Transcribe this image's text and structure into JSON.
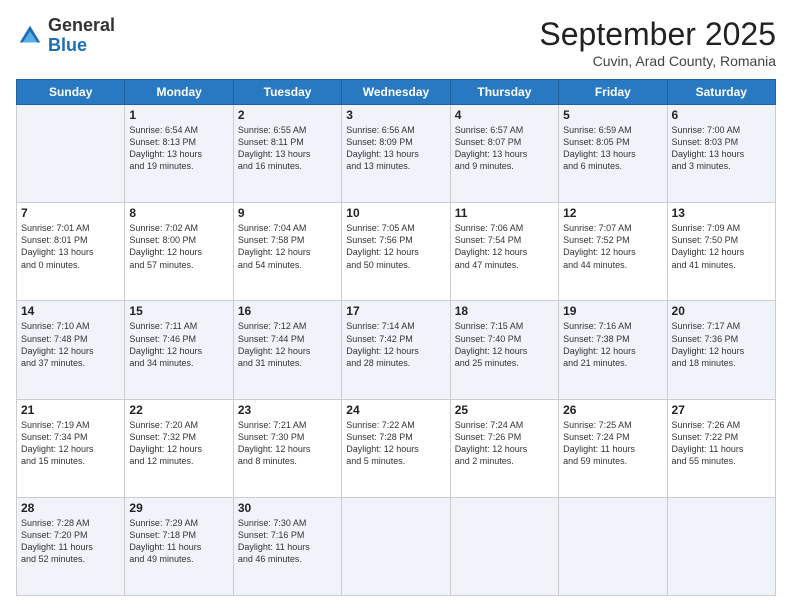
{
  "header": {
    "logo": {
      "general": "General",
      "blue": "Blue"
    },
    "title": "September 2025",
    "subtitle": "Cuvin, Arad County, Romania"
  },
  "weekdays": [
    "Sunday",
    "Monday",
    "Tuesday",
    "Wednesday",
    "Thursday",
    "Friday",
    "Saturday"
  ],
  "weeks": [
    [
      {
        "day": "",
        "info": ""
      },
      {
        "day": "1",
        "info": "Sunrise: 6:54 AM\nSunset: 8:13 PM\nDaylight: 13 hours\nand 19 minutes."
      },
      {
        "day": "2",
        "info": "Sunrise: 6:55 AM\nSunset: 8:11 PM\nDaylight: 13 hours\nand 16 minutes."
      },
      {
        "day": "3",
        "info": "Sunrise: 6:56 AM\nSunset: 8:09 PM\nDaylight: 13 hours\nand 13 minutes."
      },
      {
        "day": "4",
        "info": "Sunrise: 6:57 AM\nSunset: 8:07 PM\nDaylight: 13 hours\nand 9 minutes."
      },
      {
        "day": "5",
        "info": "Sunrise: 6:59 AM\nSunset: 8:05 PM\nDaylight: 13 hours\nand 6 minutes."
      },
      {
        "day": "6",
        "info": "Sunrise: 7:00 AM\nSunset: 8:03 PM\nDaylight: 13 hours\nand 3 minutes."
      }
    ],
    [
      {
        "day": "7",
        "info": "Sunrise: 7:01 AM\nSunset: 8:01 PM\nDaylight: 13 hours\nand 0 minutes."
      },
      {
        "day": "8",
        "info": "Sunrise: 7:02 AM\nSunset: 8:00 PM\nDaylight: 12 hours\nand 57 minutes."
      },
      {
        "day": "9",
        "info": "Sunrise: 7:04 AM\nSunset: 7:58 PM\nDaylight: 12 hours\nand 54 minutes."
      },
      {
        "day": "10",
        "info": "Sunrise: 7:05 AM\nSunset: 7:56 PM\nDaylight: 12 hours\nand 50 minutes."
      },
      {
        "day": "11",
        "info": "Sunrise: 7:06 AM\nSunset: 7:54 PM\nDaylight: 12 hours\nand 47 minutes."
      },
      {
        "day": "12",
        "info": "Sunrise: 7:07 AM\nSunset: 7:52 PM\nDaylight: 12 hours\nand 44 minutes."
      },
      {
        "day": "13",
        "info": "Sunrise: 7:09 AM\nSunset: 7:50 PM\nDaylight: 12 hours\nand 41 minutes."
      }
    ],
    [
      {
        "day": "14",
        "info": "Sunrise: 7:10 AM\nSunset: 7:48 PM\nDaylight: 12 hours\nand 37 minutes."
      },
      {
        "day": "15",
        "info": "Sunrise: 7:11 AM\nSunset: 7:46 PM\nDaylight: 12 hours\nand 34 minutes."
      },
      {
        "day": "16",
        "info": "Sunrise: 7:12 AM\nSunset: 7:44 PM\nDaylight: 12 hours\nand 31 minutes."
      },
      {
        "day": "17",
        "info": "Sunrise: 7:14 AM\nSunset: 7:42 PM\nDaylight: 12 hours\nand 28 minutes."
      },
      {
        "day": "18",
        "info": "Sunrise: 7:15 AM\nSunset: 7:40 PM\nDaylight: 12 hours\nand 25 minutes."
      },
      {
        "day": "19",
        "info": "Sunrise: 7:16 AM\nSunset: 7:38 PM\nDaylight: 12 hours\nand 21 minutes."
      },
      {
        "day": "20",
        "info": "Sunrise: 7:17 AM\nSunset: 7:36 PM\nDaylight: 12 hours\nand 18 minutes."
      }
    ],
    [
      {
        "day": "21",
        "info": "Sunrise: 7:19 AM\nSunset: 7:34 PM\nDaylight: 12 hours\nand 15 minutes."
      },
      {
        "day": "22",
        "info": "Sunrise: 7:20 AM\nSunset: 7:32 PM\nDaylight: 12 hours\nand 12 minutes."
      },
      {
        "day": "23",
        "info": "Sunrise: 7:21 AM\nSunset: 7:30 PM\nDaylight: 12 hours\nand 8 minutes."
      },
      {
        "day": "24",
        "info": "Sunrise: 7:22 AM\nSunset: 7:28 PM\nDaylight: 12 hours\nand 5 minutes."
      },
      {
        "day": "25",
        "info": "Sunrise: 7:24 AM\nSunset: 7:26 PM\nDaylight: 12 hours\nand 2 minutes."
      },
      {
        "day": "26",
        "info": "Sunrise: 7:25 AM\nSunset: 7:24 PM\nDaylight: 11 hours\nand 59 minutes."
      },
      {
        "day": "27",
        "info": "Sunrise: 7:26 AM\nSunset: 7:22 PM\nDaylight: 11 hours\nand 55 minutes."
      }
    ],
    [
      {
        "day": "28",
        "info": "Sunrise: 7:28 AM\nSunset: 7:20 PM\nDaylight: 11 hours\nand 52 minutes."
      },
      {
        "day": "29",
        "info": "Sunrise: 7:29 AM\nSunset: 7:18 PM\nDaylight: 11 hours\nand 49 minutes."
      },
      {
        "day": "30",
        "info": "Sunrise: 7:30 AM\nSunset: 7:16 PM\nDaylight: 11 hours\nand 46 minutes."
      },
      {
        "day": "",
        "info": ""
      },
      {
        "day": "",
        "info": ""
      },
      {
        "day": "",
        "info": ""
      },
      {
        "day": "",
        "info": ""
      }
    ]
  ]
}
